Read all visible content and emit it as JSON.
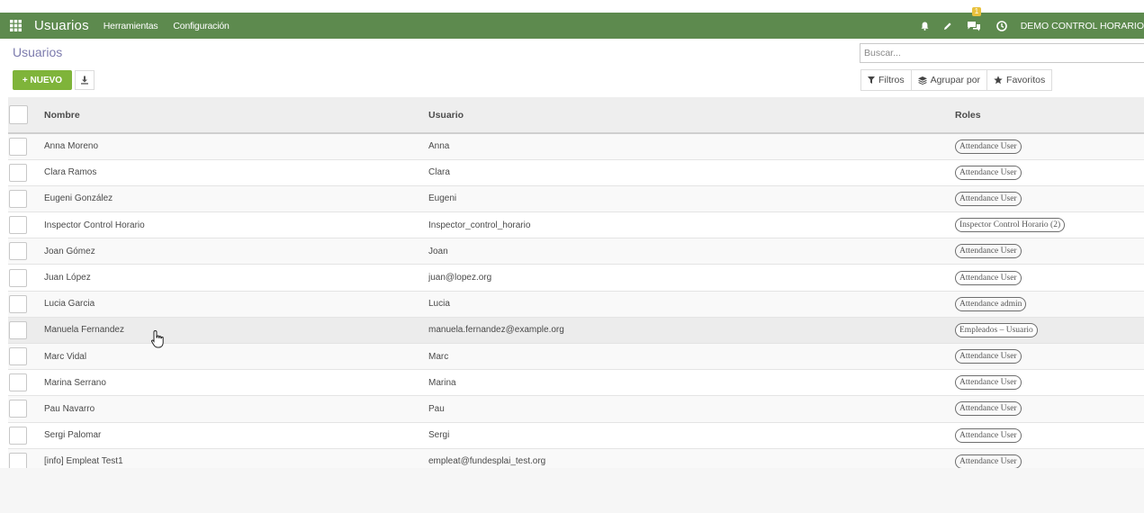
{
  "navbar": {
    "app_name": "Usuarios",
    "menus": [
      "Herramientas",
      "Configuración"
    ],
    "chat_badge": "1",
    "company": "DEMO CONTROL HORARIO"
  },
  "control_panel": {
    "title": "Usuarios",
    "search_placeholder": "Buscar...",
    "new_button": "+ NUEVO",
    "filters": "Filtros",
    "group_by": "Agrupar por",
    "favorites": "Favoritos"
  },
  "table": {
    "columns": [
      "Nombre",
      "Usuario",
      "Roles"
    ],
    "rows": [
      {
        "name": "Anna Moreno",
        "user": "Anna",
        "role": "Attendance User"
      },
      {
        "name": "Clara Ramos",
        "user": "Clara",
        "role": "Attendance User"
      },
      {
        "name": "Eugeni González",
        "user": "Eugeni",
        "role": "Attendance User"
      },
      {
        "name": "Inspector Control Horario",
        "user": "Inspector_control_horario",
        "role": "Inspector Control Horario (2)"
      },
      {
        "name": "Joan Gómez",
        "user": "Joan",
        "role": "Attendance User"
      },
      {
        "name": "Juan López",
        "user": "juan@lopez.org",
        "role": "Attendance User"
      },
      {
        "name": "Lucia Garcia",
        "user": "Lucia",
        "role": "Attendance admin"
      },
      {
        "name": "Manuela Fernandez",
        "user": "manuela.fernandez@example.org",
        "role": "Empleados – Usuario"
      },
      {
        "name": "Marc Vidal",
        "user": "Marc",
        "role": "Attendance User"
      },
      {
        "name": "Marina Serrano",
        "user": "Marina",
        "role": "Attendance User"
      },
      {
        "name": "Pau Navarro",
        "user": "Pau",
        "role": "Attendance User"
      },
      {
        "name": "Sergi Palomar",
        "user": "Sergi",
        "role": "Attendance User"
      },
      {
        "name": "[info] Empleat Test1",
        "user": "empleat@fundesplai_test.org",
        "role": "Attendance User"
      }
    ],
    "hovered_row": 7
  },
  "colors": {
    "navbar": "#5d8a4e",
    "new_button": "#7fb43a",
    "title": "#7c7bad"
  },
  "icons": {
    "apps": "grid-icon",
    "bell": "bell-icon",
    "edit": "pencil-icon",
    "chat": "chat-icon",
    "clock": "clock-icon",
    "download": "download-icon",
    "filter": "funnel-icon",
    "group": "layers-icon",
    "favorite": "star-icon"
  }
}
